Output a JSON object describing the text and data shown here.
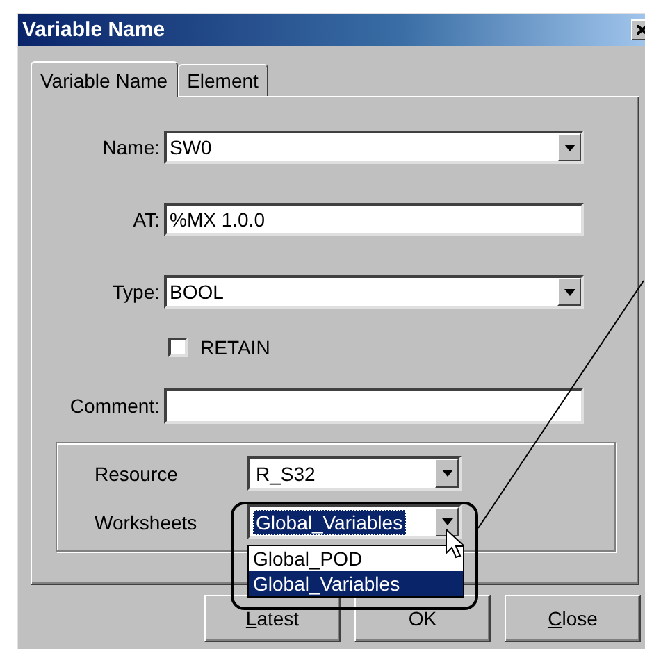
{
  "window": {
    "title": "Variable Name"
  },
  "tabs": [
    {
      "label": "Variable Name",
      "selected": true
    },
    {
      "label": "Element",
      "selected": false
    }
  ],
  "fields": [
    {
      "kind": "combo",
      "label": "Name:",
      "value": "SW0"
    },
    {
      "kind": "text",
      "label": "AT:",
      "value": "%MX 1.0.0"
    },
    {
      "kind": "combo",
      "label": "Type:",
      "value": "BOOL"
    },
    {
      "kind": "checkbox",
      "label": "RETAIN",
      "checked": false
    },
    {
      "kind": "text",
      "label": "Comment:"
    }
  ],
  "group": {
    "rows": [
      {
        "label": "Resource",
        "value": "R_S32",
        "highlighted": false
      },
      {
        "label": "Worksheets",
        "value": "Global_Variables",
        "highlighted": true
      }
    ]
  },
  "dropdown": {
    "options": [
      {
        "label": "Global_POD",
        "selected": false
      },
      {
        "label": "Global_Variables",
        "selected": true
      }
    ]
  },
  "buttons": [
    {
      "label": "Latest",
      "underline_first": true
    },
    {
      "label": "OK",
      "underline_first": false
    },
    {
      "label": "Close",
      "underline_first": true
    }
  ]
}
